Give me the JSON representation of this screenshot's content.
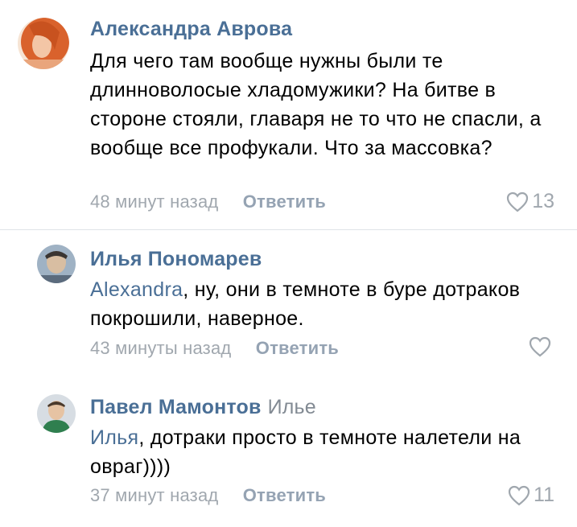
{
  "comments": [
    {
      "author": "Александра Аврова",
      "reply_to": "",
      "mention": "",
      "text": "Для чего там вообще нужны были те длинноволосые хладомужики? На битве в стороне стояли,  главаря не то что не спасли,  а вообще все профукали. Что за массовка?",
      "time": "48 минут назад",
      "reply_label": "Ответить",
      "likes": "13",
      "avatar_colors": [
        "#e0773a",
        "#f2c1a0"
      ]
    },
    {
      "author": "Илья Пономарев",
      "reply_to": "",
      "mention": "Alexandra",
      "text": ", ну, они в темноте в буре дотраков покрошили, наверное.",
      "time": "43 минуты назад",
      "reply_label": "Ответить",
      "likes": "",
      "avatar_colors": [
        "#8fa3b8",
        "#d9c2a8"
      ]
    },
    {
      "author": "Павел Мамонтов",
      "reply_to": "Илье",
      "mention": "Илья",
      "text": ", дотраки просто в темноте налетели на овраг))))",
      "time": "37 минут назад",
      "reply_label": "Ответить",
      "likes": "11",
      "avatar_colors": [
        "#3f8a5a",
        "#e8cbb0"
      ]
    }
  ],
  "icons": {
    "like": "heart-outline-icon"
  }
}
